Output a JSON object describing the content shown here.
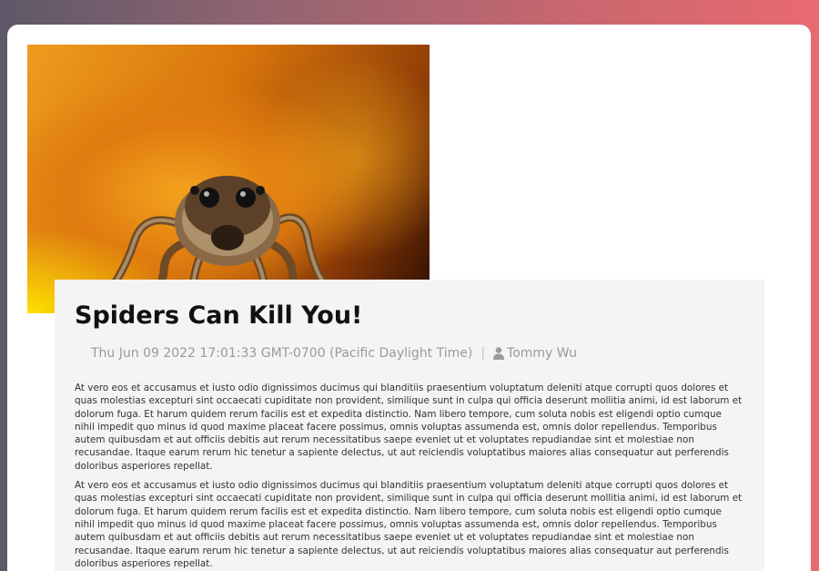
{
  "post": {
    "image_alt": "Jumping spider on orange background",
    "title": "Spiders Can Kill You!",
    "date": "Thu Jun 09 2022 17:01:33 GMT-0700 (Pacific Daylight Time)",
    "separator": "|",
    "author_icon": "user-icon",
    "author": "Tommy Wu",
    "paragraphs": [
      "At vero eos et accusamus et iusto odio dignissimos ducimus qui blanditiis praesentium voluptatum deleniti atque corrupti quos dolores et quas molestias excepturi sint occaecati cupiditate non provident, similique sunt in culpa qui officia deserunt mollitia animi, id est laborum et dolorum fuga. Et harum quidem rerum facilis est et expedita distinctio. Nam libero tempore, cum soluta nobis est eligendi optio cumque nihil impedit quo minus id quod maxime placeat facere possimus, omnis voluptas assumenda est, omnis dolor repellendus. Temporibus autem quibusdam et aut officiis debitis aut rerum necessitatibus saepe eveniet ut et voluptates repudiandae sint et molestiae non recusandae. Itaque earum rerum hic tenetur a sapiente delectus, ut aut reiciendis voluptatibus maiores alias consequatur aut perferendis doloribus asperiores repellat.",
      "At vero eos et accusamus et iusto odio dignissimos ducimus qui blanditiis praesentium voluptatum deleniti atque corrupti quos dolores et quas molestias excepturi sint occaecati cupiditate non provident, similique sunt in culpa qui officia deserunt mollitia animi, id est laborum et dolorum fuga. Et harum quidem rerum facilis est et expedita distinctio. Nam libero tempore, cum soluta nobis est eligendi optio cumque nihil impedit quo minus id quod maxime placeat facere possimus, omnis voluptas assumenda est, omnis dolor repellendus. Temporibus autem quibusdam et aut officiis debitis aut rerum necessitatibus saepe eveniet ut et voluptates repudiandae sint et molestiae non recusandae. Itaque earum rerum hic tenetur a sapiente delectus, ut aut reiciendis voluptatibus maiores alias consequatur aut perferendis doloribus asperiores repellat."
    ]
  },
  "colors": {
    "page_gradient_start": "#5e5868",
    "page_gradient_end": "#e96a70",
    "card": "#ffffff",
    "post_panel": "#f4f4f4",
    "title_text": "#111111",
    "meta_text": "#9a9a9a",
    "body_text": "#333333"
  }
}
